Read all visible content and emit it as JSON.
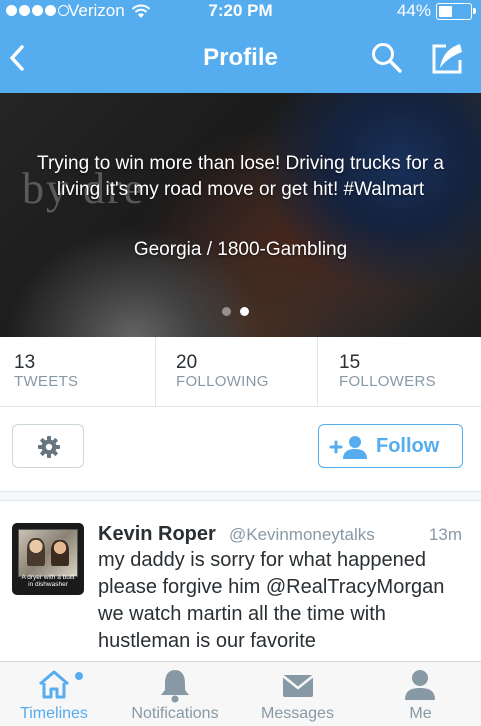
{
  "status_bar": {
    "carrier": "Verizon",
    "time": "7:20 PM",
    "battery": "44%",
    "battery_level": 0.44,
    "signal_bars": 4
  },
  "nav": {
    "title": "Profile",
    "back_icon": "chevron-left-icon",
    "search_icon": "search-icon",
    "compose_icon": "compose-icon"
  },
  "profile": {
    "banner_watermark": "by dre",
    "bio": "Trying to win more than lose! Driving trucks for a living it's my road move or get hit! #Walmart",
    "location": "Georgia / 1800-Gambling",
    "banner_pages": 2,
    "banner_active_page": 2
  },
  "stats": [
    {
      "count": "13",
      "label": "TWEETS"
    },
    {
      "count": "20",
      "label": "FOLLOWING"
    },
    {
      "count": "15",
      "label": "FOLLOWERS"
    }
  ],
  "actions": {
    "settings_icon": "gear-icon",
    "follow_label": "Follow",
    "follow_icon": "add-user-icon"
  },
  "tweet": {
    "name": "Kevin Roper",
    "handle": "@Kevinmoneytalks",
    "time": "13m",
    "text": "my daddy is sorry for what happened please forgive him @RealTracyMorgan we watch martin all the time with hustleman is our favorite",
    "avatar_caption_1": "A dryer with a built",
    "avatar_caption_2": "in dishwasher"
  },
  "tabbar": {
    "tabs": [
      {
        "label": "Timelines",
        "icon": "home-icon",
        "active": true
      },
      {
        "label": "Notifications",
        "icon": "bell-icon",
        "active": false
      },
      {
        "label": "Messages",
        "icon": "envelope-icon",
        "active": false
      },
      {
        "label": "Me",
        "icon": "person-icon",
        "active": false
      }
    ]
  },
  "colors": {
    "brand": "#55acee",
    "text": "#292f33",
    "muted": "#8899a6"
  }
}
